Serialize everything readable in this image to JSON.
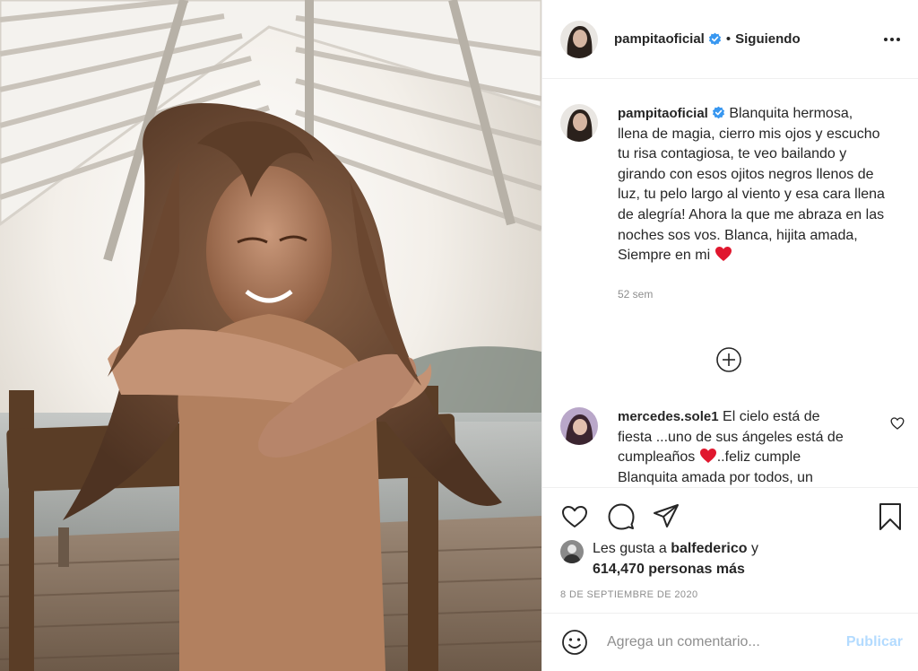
{
  "post": {
    "image_description_icon": "photo-post-image"
  },
  "header": {
    "username": "pampitaoficial",
    "separator": "•",
    "follow_status": "Siguiendo",
    "more_icon": "more-options-icon"
  },
  "caption": {
    "username": "pampitaoficial",
    "text": "Blanquita hermosa, llena de magia, cierro mis ojos y escucho tu risa contagiosa, te veo bailando y girando con esos ojitos negros llenos de luz, tu pelo largo al viento y esa cara llena de alegría! Ahora la que me abraza en las noches sos vos. Blanca, hijita amada, Siempre en mi",
    "time_ago": "52 sem"
  },
  "comments": [
    {
      "username": "mercedes.sole1",
      "text_before_emoji": "El cielo está de fiesta ...uno de sus ángeles está de cumpleaños",
      "text_after_emoji": "..feliz cumple Blanquita amada por todos, un"
    }
  ],
  "likes": {
    "prefix": "Les gusta a",
    "user": "balfederico",
    "conj": "y",
    "count": "614,470 personas más"
  },
  "date": "8 DE SEPTIEMBRE DE 2020",
  "add_comment": {
    "placeholder": "Agrega un comentario...",
    "publish_label": "Publicar"
  },
  "colors": {
    "verified": "#3897f0",
    "heart_red": "#e0172e",
    "publish_disabled": "#b3dbff",
    "muted": "#8e8e8e"
  }
}
